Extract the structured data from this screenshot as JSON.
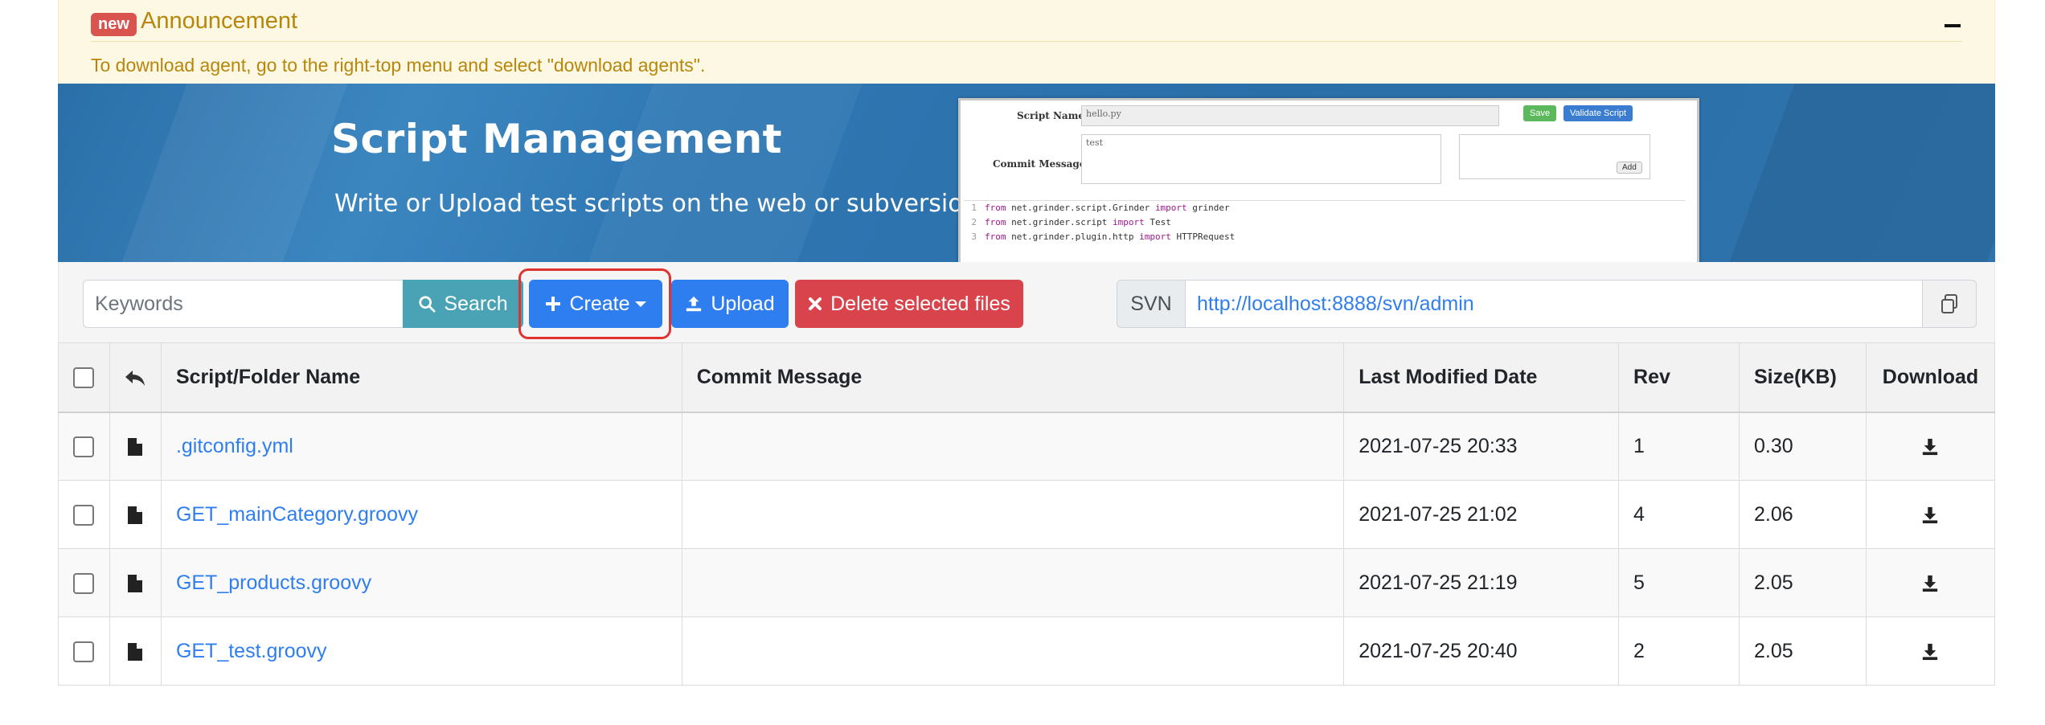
{
  "announcement": {
    "badge": "new",
    "title": "Announcement",
    "text": "To download agent, go to the right-top menu and select \"download agents\"."
  },
  "banner": {
    "title": "Script Management",
    "subtitle": "Write or Upload test scripts on the web or subversion",
    "mock": {
      "script_name_label": "Script Name",
      "script_name_value": "hello.py",
      "commit_label": "Commit Message",
      "commit_value": "test",
      "save_label": "Save",
      "validate_label": "Validate Script",
      "add_label": "Add",
      "code_lines": [
        {
          "num": "1",
          "kw1": "from",
          "mod": " net.grinder.script.Grinder ",
          "kw2": "import",
          "name": " grinder"
        },
        {
          "num": "2",
          "kw1": "from",
          "mod": " net.grinder.script ",
          "kw2": "import",
          "name": " Test"
        },
        {
          "num": "3",
          "kw1": "from",
          "mod": " net.grinder.plugin.http ",
          "kw2": "import",
          "name": " HTTPRequest"
        }
      ]
    }
  },
  "toolbar": {
    "search_placeholder": "Keywords",
    "search_label": "Search",
    "create_label": "Create",
    "upload_label": "Upload",
    "delete_label": "Delete selected files",
    "svn_label": "SVN",
    "svn_url": "http://localhost:8888/svn/admin"
  },
  "table": {
    "headers": {
      "name": "Script/Folder Name",
      "commit": "Commit Message",
      "date": "Last Modified Date",
      "rev": "Rev",
      "size": "Size(KB)",
      "download": "Download"
    },
    "rows": [
      {
        "name": ".gitconfig.yml",
        "commit": "",
        "date": "2021-07-25 20:33",
        "rev": "1",
        "size": "0.30"
      },
      {
        "name": "GET_mainCategory.groovy",
        "commit": "",
        "date": "2021-07-25 21:02",
        "rev": "4",
        "size": "2.06"
      },
      {
        "name": "GET_products.groovy",
        "commit": "",
        "date": "2021-07-25 21:19",
        "rev": "5",
        "size": "2.05"
      },
      {
        "name": "GET_test.groovy",
        "commit": "",
        "date": "2021-07-25 20:40",
        "rev": "2",
        "size": "2.05"
      }
    ]
  },
  "icons": {
    "search": "search-icon",
    "create": "plus-icon",
    "upload": "upload-icon",
    "delete": "times-icon",
    "copy": "copy-icon",
    "back": "reply-icon",
    "file": "file-icon",
    "download": "download-icon"
  },
  "colors": {
    "primary": "#2f7ef0",
    "info": "#4aa3b5",
    "danger": "#d9434c",
    "highlight": "#e0332f",
    "announcement_bg": "#fcf8e3"
  }
}
